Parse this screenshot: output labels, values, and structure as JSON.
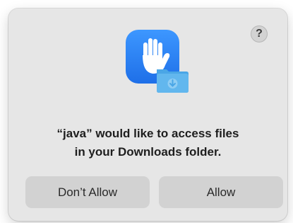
{
  "dialog": {
    "help_label": "?",
    "message_line1": "“java” would like to access files",
    "message_line2": "in your Downloads folder.",
    "icon": "privacy-hand-icon",
    "badge_icon": "downloads-folder-icon"
  },
  "buttons": {
    "deny_label": "Don’t Allow",
    "allow_label": "Allow"
  },
  "colors": {
    "dialog_background": "#e6e6e6",
    "button_background": "#d2d2d2",
    "icon_blue": "#2f86f6",
    "folder_blue": "#5fb3ea"
  }
}
